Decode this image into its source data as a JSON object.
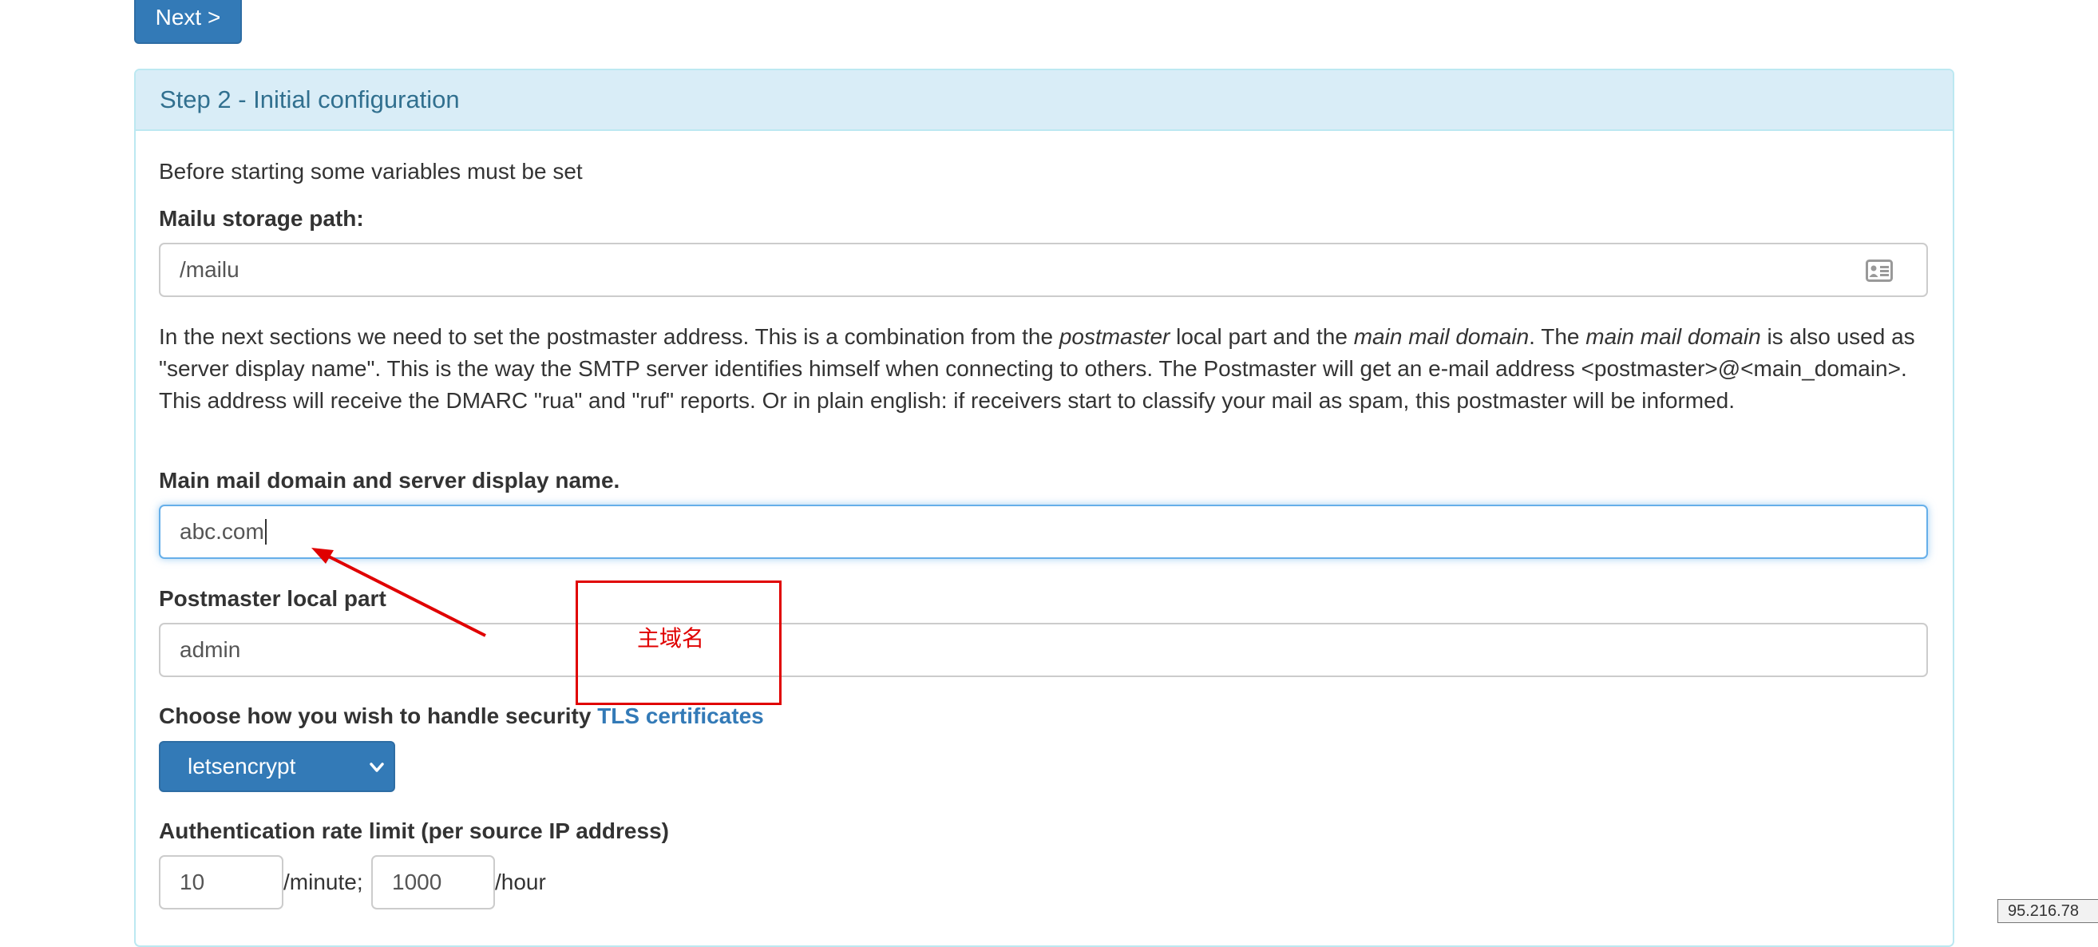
{
  "header": {
    "next_label": "Next >"
  },
  "panel": {
    "title": "Step 2 - Initial configuration",
    "intro": "Before starting some variables must be set"
  },
  "storage": {
    "label": "Mailu storage path:",
    "value": "/mailu",
    "icon": "contact-card-icon"
  },
  "description": {
    "p1": "In the next sections we need to set the postmaster address. This is a combination from the ",
    "em1": "postmaster",
    "p2": " local part and the ",
    "em2": "main mail domain",
    "p3": ". The ",
    "em3": "main mail domain",
    "p4": " is also used as \"server display name\". This is the way the SMTP server identifies himself when connecting to others. The Postmaster will get an e-mail address <postmaster>@<main_domain>. This address will receive the DMARC \"rua\" and \"ruf\" reports. Or in plain english: if receivers start to classify your mail as spam, this postmaster will be informed."
  },
  "domain": {
    "label": "Main mail domain and server display name.",
    "value": "abc.com"
  },
  "postmaster": {
    "label": "Postmaster local part",
    "value": "admin"
  },
  "tls": {
    "label": "Choose how you wish to handle security ",
    "link": "TLS certificates",
    "selected": "letsencrypt"
  },
  "ratelimit": {
    "label": "Authentication rate limit (per source IP address)",
    "per_minute_value": "10",
    "minute_unit": "/minute;",
    "per_hour_value": "1000",
    "hour_unit": "/hour"
  },
  "annotation": {
    "text": "主域名",
    "color": "#e00000"
  },
  "footer": {
    "ip_text": "95.216.78"
  },
  "colors": {
    "primary": "#337ab7",
    "panel_heading_bg": "#d9edf7",
    "panel_heading_text": "#31708f",
    "annotation": "#e00000"
  }
}
